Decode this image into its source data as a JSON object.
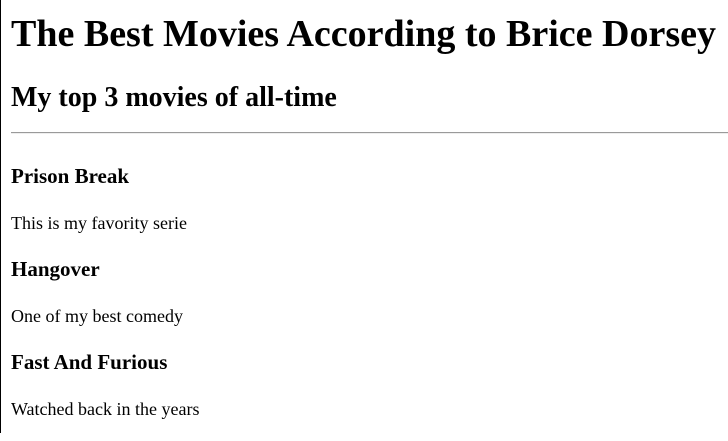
{
  "page": {
    "title": "The Best Movies According to Brice Dorsey",
    "subtitle": "My top 3 movies of all-time"
  },
  "movies": [
    {
      "title": "Prison Break",
      "description": "This is my favority serie"
    },
    {
      "title": "Hangover",
      "description": "One of my best comedy"
    },
    {
      "title": "Fast And Furious",
      "description": "Watched back in the years"
    }
  ]
}
